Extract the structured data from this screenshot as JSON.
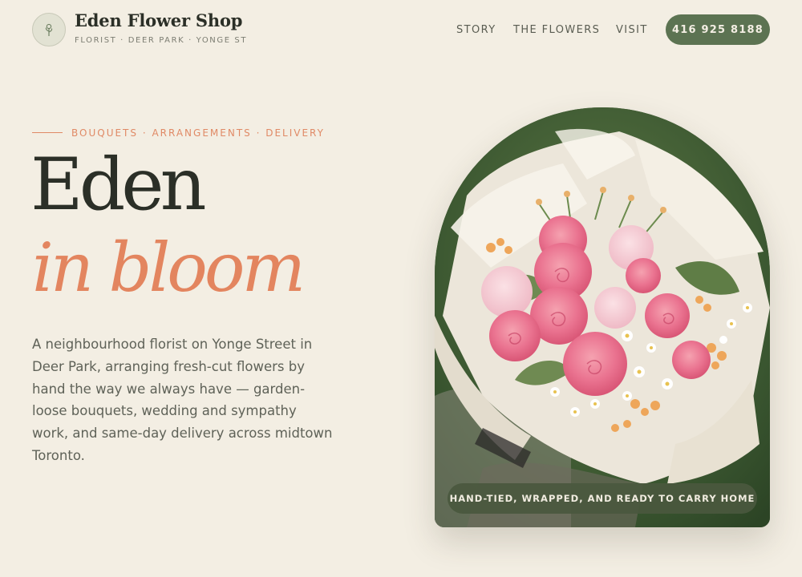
{
  "header": {
    "brand_name": "Eden Flower Shop",
    "brand_tagline": "FLORIST · DEER PARK · YONGE ST",
    "logo_icon": "flower-stem-icon",
    "nav": [
      {
        "label": "STORY"
      },
      {
        "label": "THE FLOWERS"
      },
      {
        "label": "VISIT"
      }
    ],
    "phone_label": "416 925 8188"
  },
  "hero": {
    "eyebrow": "BOUQUETS · ARRANGEMENTS · DELIVERY",
    "title_line1": "Eden",
    "title_line2": "in bloom",
    "description": "A neighbourhood florist on Yonge Street in Deer Park, arranging fresh-cut flowers by hand the way we always have — garden-loose bouquets, wedding and sympathy work, and same-day delivery across midtown Toronto.",
    "image_caption": "HAND-TIED, WRAPPED, AND READY TO CARRY HOME"
  },
  "colors": {
    "background": "#f3eee3",
    "accent_green": "#5c7352",
    "accent_coral": "#e3855f",
    "text_dark": "#2b2f27"
  }
}
